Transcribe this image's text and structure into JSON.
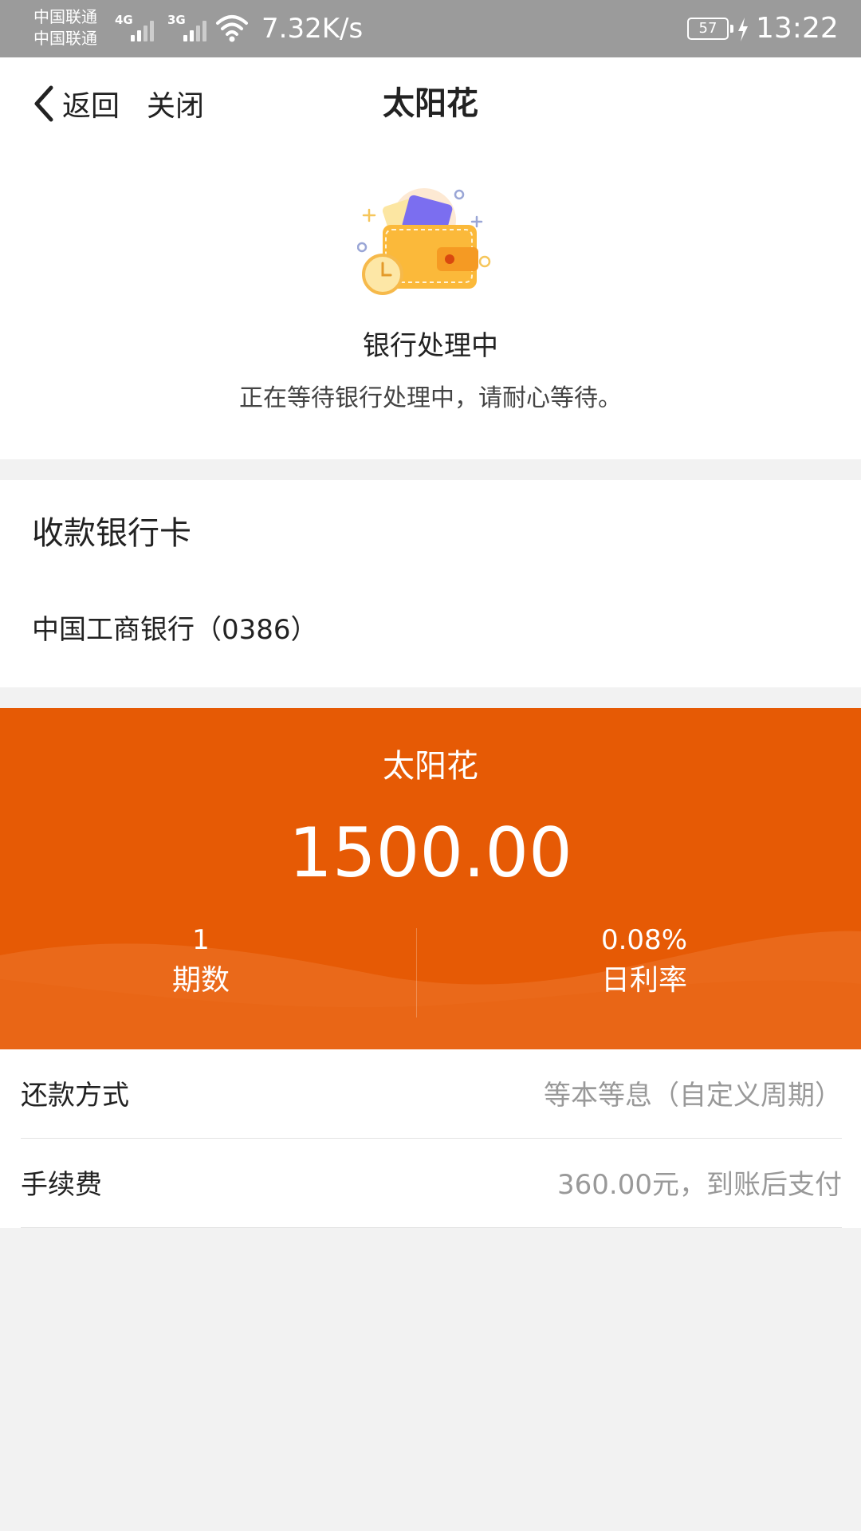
{
  "status_bar": {
    "carrier_1": "中国联通",
    "carrier_2": "中国联通",
    "signal_1_type": "4G",
    "signal_2_type": "3G",
    "net_speed": "7.32K/s",
    "battery": "57",
    "time": "13:22",
    "icons": [
      "signal-icon",
      "wifi-icon",
      "battery-icon",
      "charging-bolt-icon"
    ]
  },
  "nav": {
    "back_label": "返回",
    "close_label": "关闭",
    "title": "太阳花",
    "icons": [
      "chevron-left-icon"
    ]
  },
  "status": {
    "icon": "wallet-icon",
    "title": "银行处理中",
    "description": "正在等待银行处理中，请耐心等待。"
  },
  "receiving_card": {
    "heading": "收款银行卡",
    "bank": "中国工商银行（0386）"
  },
  "loan": {
    "name": "太阳花",
    "amount": "1500.00",
    "periods_value": "1",
    "periods_label": "期数",
    "rate_value": "0.08%",
    "rate_label": "日利率"
  },
  "details": [
    {
      "label": "还款方式",
      "value": "等本等息（自定义周期）"
    },
    {
      "label": "手续费",
      "value": "360.00元，到账后支付"
    }
  ],
  "colors": {
    "accent": "#e65a05",
    "status_bar": "#9b9b9b",
    "background": "#f2f2f2"
  }
}
